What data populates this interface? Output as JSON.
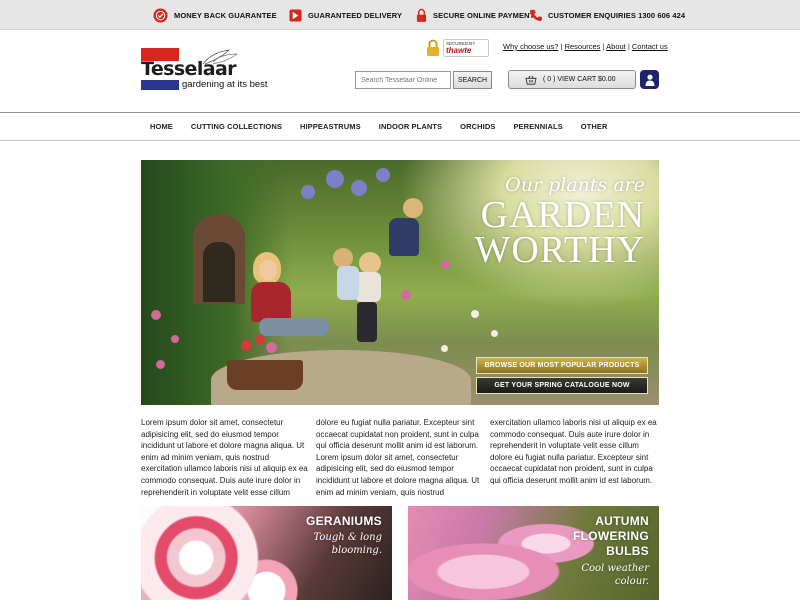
{
  "topbar": {
    "items": [
      {
        "label": "MONEY BACK GUARANTEE",
        "icon": "badge-icon"
      },
      {
        "label": "GUARANTEED DELIVERY",
        "icon": "delivery-icon"
      },
      {
        "label": "SECURE ONLINE PAYMENT",
        "icon": "lock-icon"
      },
      {
        "label": "CUSTOMER ENQUIRIES 1300 606 424",
        "icon": "phone-icon"
      }
    ],
    "icon_color": "#d7261e"
  },
  "header": {
    "logo_word": "Tesselaar",
    "logo_tagline": "gardening at its best",
    "security_badge": {
      "secured_by": "SECURED BY",
      "brand": "thawte"
    },
    "links": [
      "Why choose us?",
      "Resources",
      "About",
      "Contact us"
    ],
    "search": {
      "placeholder": "Search Tesselaar Online",
      "button": "SEARCH"
    },
    "cart": {
      "label": "( 0 ) VIEW CART $0.00"
    }
  },
  "nav": {
    "items": [
      "HOME",
      "CUTTING COLLECTIONS",
      "HIPPEASTRUMS",
      "INDOOR PLANTS",
      "ORCHIDS",
      "PERENNIALS",
      "OTHER"
    ]
  },
  "hero": {
    "line1": "Our plants are",
    "line2": "GARDEN",
    "line3": "WORTHY",
    "button_primary": "BROWSE OUR MOST POPULAR PRODUCTS",
    "button_secondary": "GET YOUR SPRING CATALOGUE NOW"
  },
  "body_text": {
    "col1": "Lorem ipsum dolor sit amet, consectetur adipisicing elit, sed do eiusmod tempor incididunt ut labore et dolore magna aliqua. Ut enim ad minim veniam, quis nostrud exercitation ullamco laboris nisi ut aliquip ex ea commodo consequat. Duis aute irure dolor in reprehenderit in voluptate velit esse cillum",
    "col2": "dolore eu fugiat nulla pariatur. Excepteur sint occaecat cupidatat non proident, sunt in culpa qui officia deserunt mollit anim id est laborum. Lorem ipsum dolor sit amet, consectetur adipisicing elit, sed do eiusmod tempor incididunt ut labore et dolore magna aliqua. Ut enim ad minim veniam, quis nostrud",
    "col3": "exercitation ullamco laboris nisi ut aliquip ex ea commodo consequat. Duis aute irure dolor in reprehenderit in voluptate velit esse cillum dolore eu fugiat nulla pariatur. Excepteur sint occaecat cupidatat non proident, sunt in culpa qui officia deserunt mollit anim id est laborum."
  },
  "tiles": [
    {
      "title": "GERANIUMS",
      "subtitle": "Tough & long\nblooming."
    },
    {
      "title": "AUTUMN\nFLOWERING\nBULBS",
      "subtitle": "Cool weather\ncolour."
    }
  ],
  "colors": {
    "brand_red": "#d7261e",
    "brand_blue": "#2b3690",
    "user_button": "#20246e",
    "hero_primary_button": "#b39a35"
  }
}
